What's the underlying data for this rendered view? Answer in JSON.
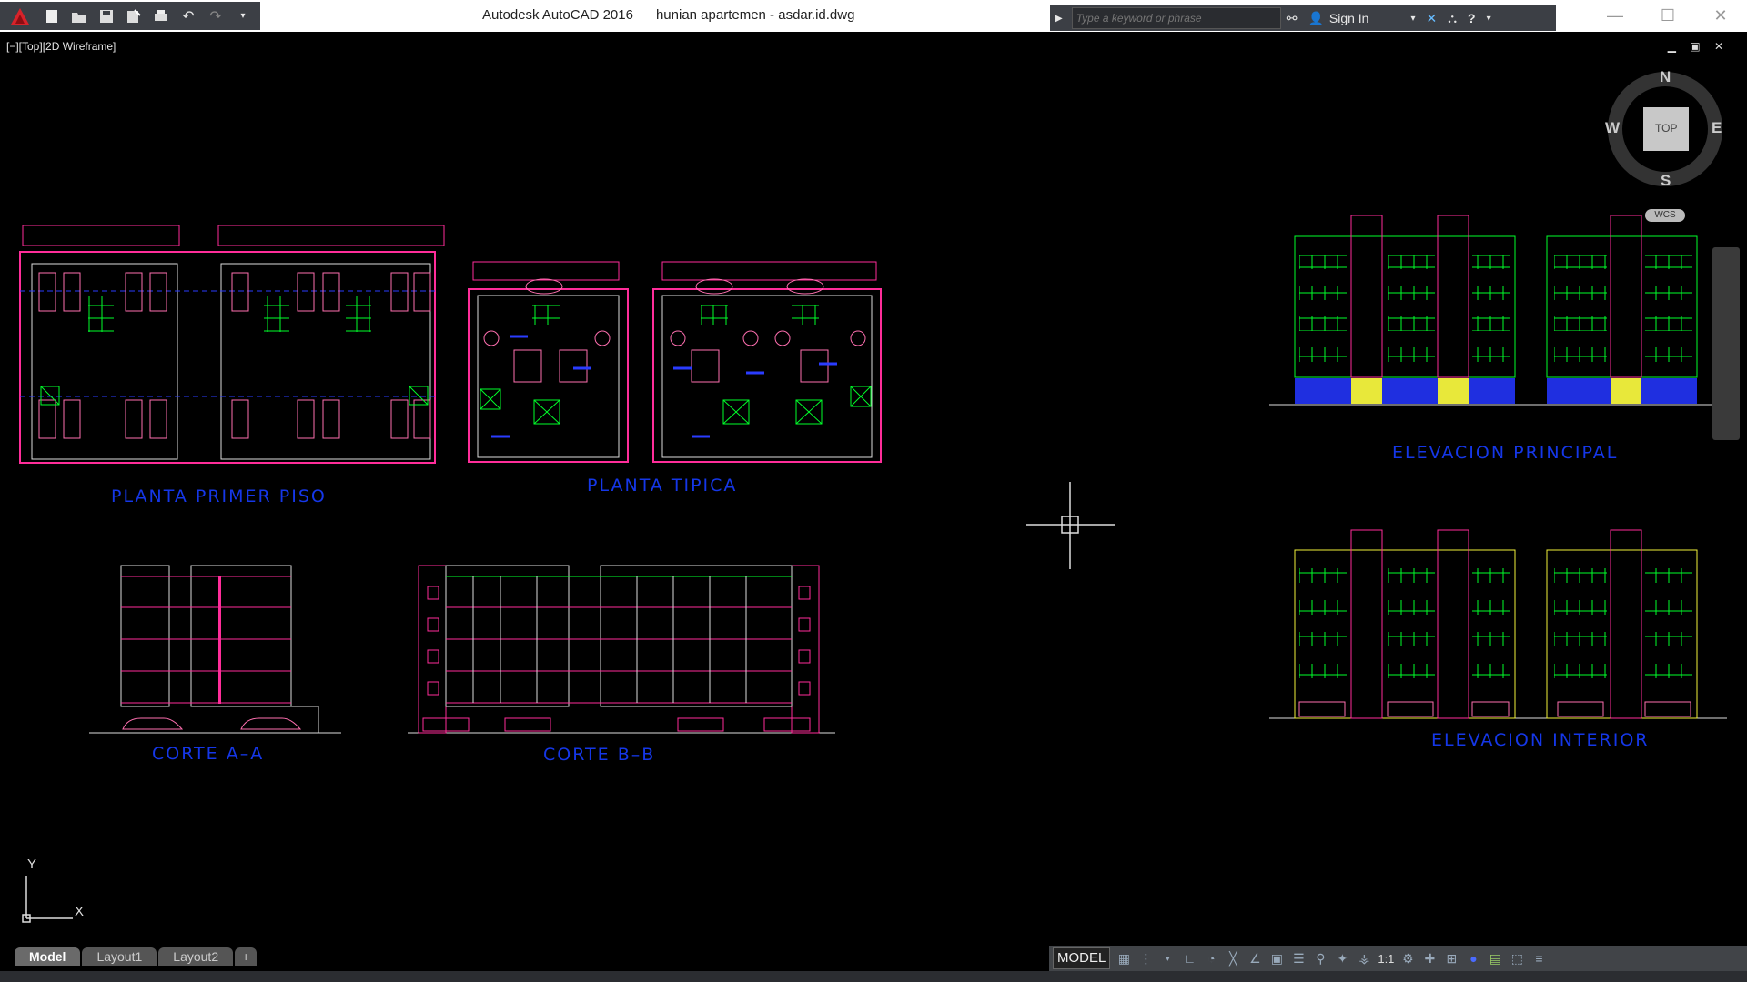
{
  "title": {
    "app": "Autodesk AutoCAD 2016",
    "file": "hunian apartemen - asdar.id.dwg"
  },
  "infocenter": {
    "search_placeholder": "Type a keyword or phrase",
    "sign_in": "Sign In"
  },
  "viewport": {
    "label": "[−][Top][2D Wireframe]",
    "controls": "▁ ▣ ✕"
  },
  "drawing_labels": {
    "planta_primer": "PLANTA PRIMER PISO",
    "planta_tipica": "PLANTA TIPICA",
    "corte_a": "CORTE A–A",
    "corte_b": "CORTE B–B",
    "elev_principal": "ELEVACION PRINCIPAL",
    "elev_interior": "ELEVACION INTERIOR"
  },
  "viewcube": {
    "n": "N",
    "s": "S",
    "e": "E",
    "w": "W",
    "face": "TOP",
    "wcs": "WCS"
  },
  "ucs": {
    "x": "X",
    "y": "Y"
  },
  "tabs": [
    "Model",
    "Layout1",
    "Layout2",
    "+"
  ],
  "status": {
    "model": "MODEL",
    "scale": "1:1"
  },
  "colors": {
    "drawing_label": "#1537e8",
    "green": "#00ff2a",
    "magenta": "#ff2d9a",
    "yellow": "#f2f23a",
    "blue": "#2a3cff"
  }
}
